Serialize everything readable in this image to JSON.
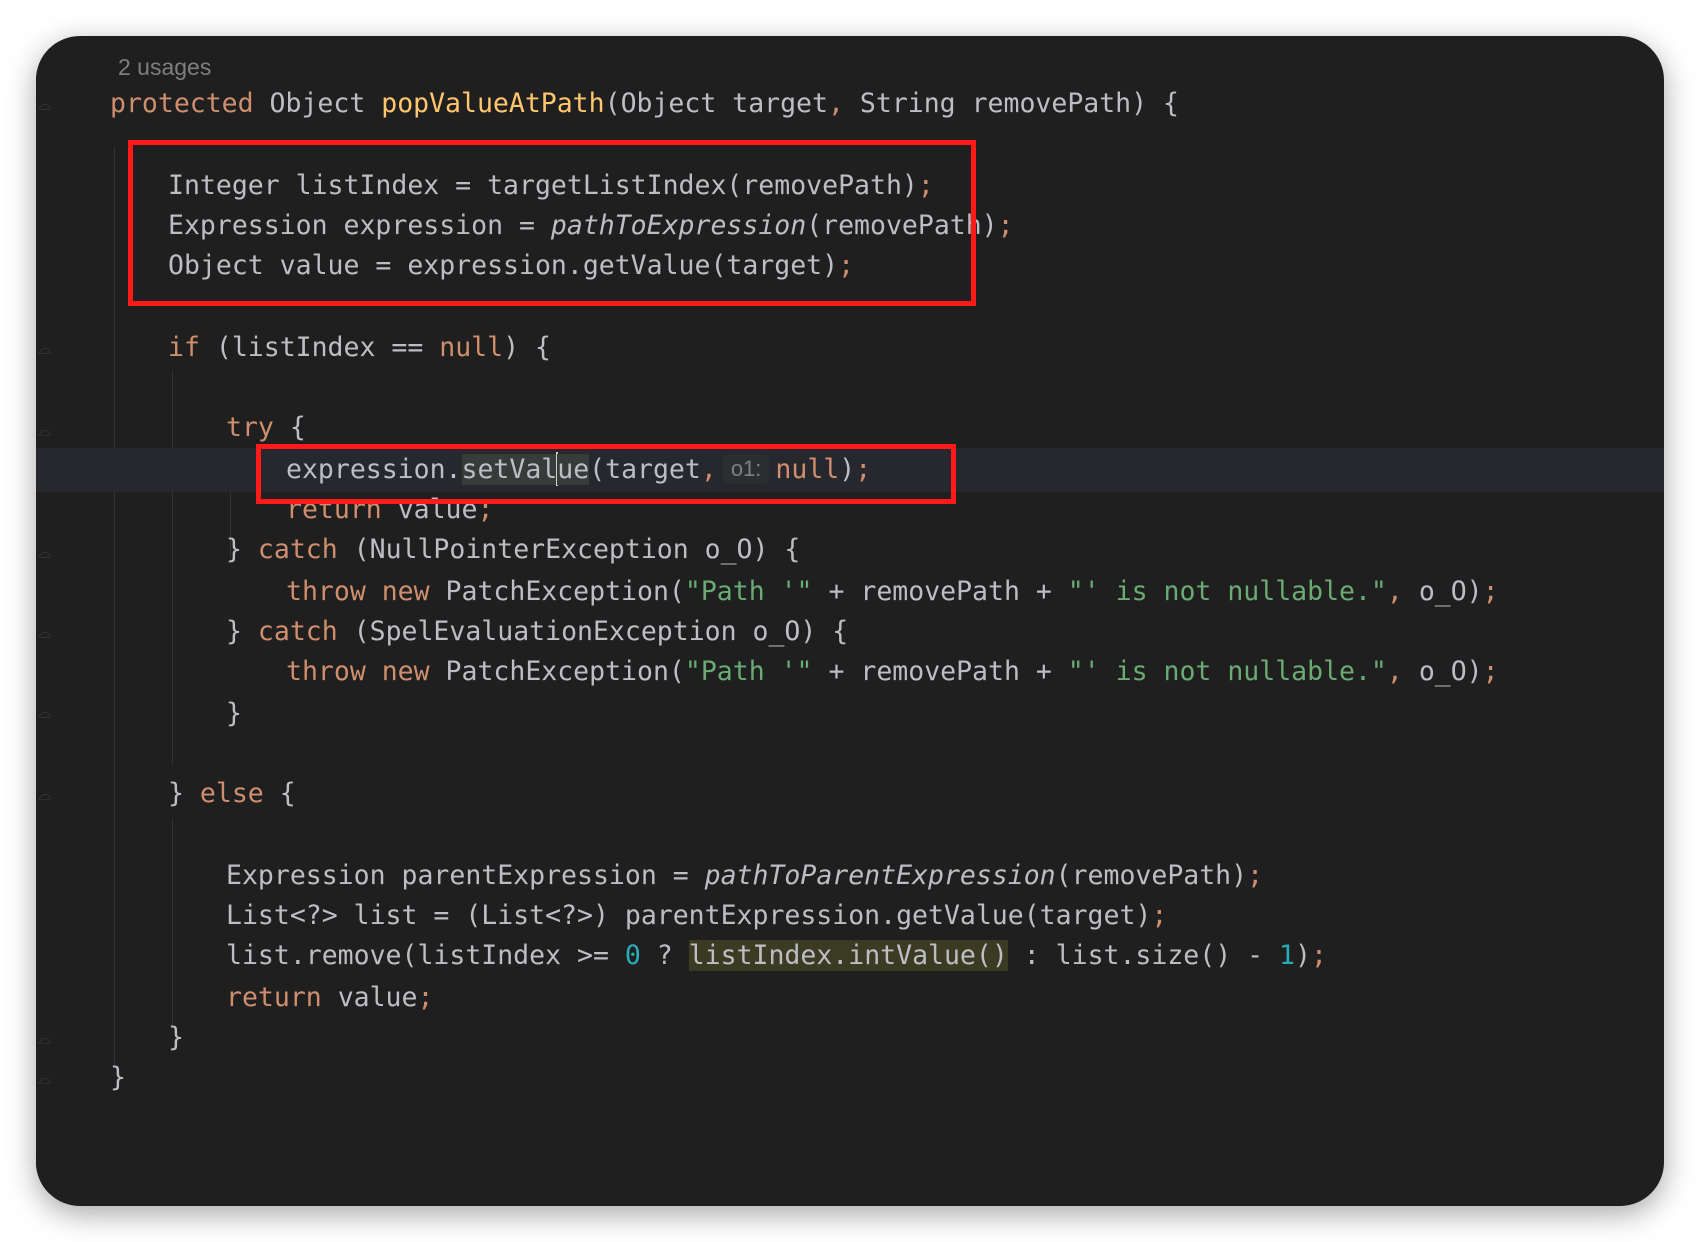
{
  "editor": {
    "usages_label": "2 usages",
    "lines": [
      {
        "id": "l-sig",
        "tokens": [
          {
            "t": "protected ",
            "c": "kw"
          },
          {
            "t": "Object "
          },
          {
            "t": "popValueAtPath",
            "c": "fn"
          },
          {
            "t": "(Object target"
          },
          {
            "t": ",",
            "c": "punct"
          },
          {
            "t": " String removePath) {"
          }
        ]
      },
      {
        "id": "l-listindex",
        "tokens": [
          {
            "t": "Integer listIndex = targetListIndex(removePath)"
          },
          {
            "t": ";",
            "c": "punct"
          }
        ]
      },
      {
        "id": "l-expression",
        "tokens": [
          {
            "t": "Expression expression = "
          },
          {
            "t": "pathToExpression",
            "c": "it"
          },
          {
            "t": "(removePath)"
          },
          {
            "t": ";",
            "c": "punct"
          }
        ]
      },
      {
        "id": "l-value",
        "tokens": [
          {
            "t": "Object value = expression.getValue(target)"
          },
          {
            "t": ";",
            "c": "punct"
          }
        ]
      },
      {
        "id": "l-if",
        "tokens": [
          {
            "t": "if",
            "c": "kw"
          },
          {
            "t": " (listIndex == "
          },
          {
            "t": "null",
            "c": "kw"
          },
          {
            "t": ") {"
          }
        ]
      },
      {
        "id": "l-try",
        "tokens": [
          {
            "t": "try",
            "c": "kw"
          },
          {
            "t": " {"
          }
        ]
      },
      {
        "id": "l-setvalue",
        "current": true,
        "tokens": [
          {
            "t": "expression."
          },
          {
            "t": "setVal",
            "c": "hl-usage"
          },
          {
            "caret": true
          },
          {
            "t": "ue",
            "c": "hl-usage"
          },
          {
            "t": "(target"
          },
          {
            "t": ",",
            "c": "punct"
          },
          {
            "hint": "o1:"
          },
          {
            "t": "null",
            "c": "kw"
          },
          {
            "t": ")"
          },
          {
            "t": ";",
            "c": "punct"
          }
        ]
      },
      {
        "id": "l-return1",
        "tokens": [
          {
            "t": "return",
            "c": "kw"
          },
          {
            "t": " value"
          },
          {
            "t": ";",
            "c": "punct"
          }
        ]
      },
      {
        "id": "l-catch1",
        "tokens": [
          {
            "t": "} "
          },
          {
            "t": "catch",
            "c": "kw"
          },
          {
            "t": " (NullPointerException o_O) {"
          }
        ]
      },
      {
        "id": "l-throw1",
        "tokens": [
          {
            "t": "throw new",
            "c": "kw"
          },
          {
            "t": " PatchException("
          },
          {
            "t": "\"Path '\"",
            "c": "str"
          },
          {
            "t": " + removePath + "
          },
          {
            "t": "\"' is not nullable.\"",
            "c": "str"
          },
          {
            "t": ",",
            "c": "punct"
          },
          {
            "t": " o_O)"
          },
          {
            "t": ";",
            "c": "punct"
          }
        ]
      },
      {
        "id": "l-catch2",
        "tokens": [
          {
            "t": "} "
          },
          {
            "t": "catch",
            "c": "kw"
          },
          {
            "t": " (SpelEvaluationException o_O) {"
          }
        ]
      },
      {
        "id": "l-throw2",
        "tokens": [
          {
            "t": "throw new",
            "c": "kw"
          },
          {
            "t": " PatchException("
          },
          {
            "t": "\"Path '\"",
            "c": "str"
          },
          {
            "t": " + removePath + "
          },
          {
            "t": "\"' is not nullable.\"",
            "c": "str"
          },
          {
            "t": ",",
            "c": "punct"
          },
          {
            "t": " o_O)"
          },
          {
            "t": ";",
            "c": "punct"
          }
        ]
      },
      {
        "id": "l-close-try",
        "tokens": [
          {
            "t": "}"
          }
        ]
      },
      {
        "id": "l-else",
        "tokens": [
          {
            "t": "} "
          },
          {
            "t": "else",
            "c": "kw"
          },
          {
            "t": " {"
          }
        ]
      },
      {
        "id": "l-parent",
        "tokens": [
          {
            "t": "Expression parentExpression = "
          },
          {
            "t": "pathToParentExpression",
            "c": "it"
          },
          {
            "t": "(removePath)"
          },
          {
            "t": ";",
            "c": "punct"
          }
        ]
      },
      {
        "id": "l-list",
        "tokens": [
          {
            "t": "List<?> list = (List<?>) parentExpression.getValue(target)"
          },
          {
            "t": ";",
            "c": "punct"
          }
        ]
      },
      {
        "id": "l-remove",
        "tokens": [
          {
            "t": "list.remove(listIndex >= "
          },
          {
            "t": "0",
            "c": "num"
          },
          {
            "t": " ? "
          },
          {
            "t": "listIndex.intValue()",
            "c": "hl-warn"
          },
          {
            "t": " : list.size() - "
          },
          {
            "t": "1",
            "c": "num"
          },
          {
            "t": ")"
          },
          {
            "t": ";",
            "c": "punct"
          }
        ]
      },
      {
        "id": "l-return2",
        "tokens": [
          {
            "t": "return",
            "c": "kw"
          },
          {
            "t": " value"
          },
          {
            "t": ";",
            "c": "punct"
          }
        ]
      },
      {
        "id": "l-close-else",
        "tokens": [
          {
            "t": "}"
          }
        ]
      },
      {
        "id": "l-close-method",
        "tokens": [
          {
            "t": "}"
          }
        ]
      }
    ]
  },
  "colors": {
    "background": "#1f1f1f",
    "keyword": "#cf8e6d",
    "method_declaration": "#ffc66d",
    "string": "#6aab73",
    "number": "#2aacb8",
    "text": "#bcbec4",
    "annotation_box": "#ff1a1a"
  }
}
